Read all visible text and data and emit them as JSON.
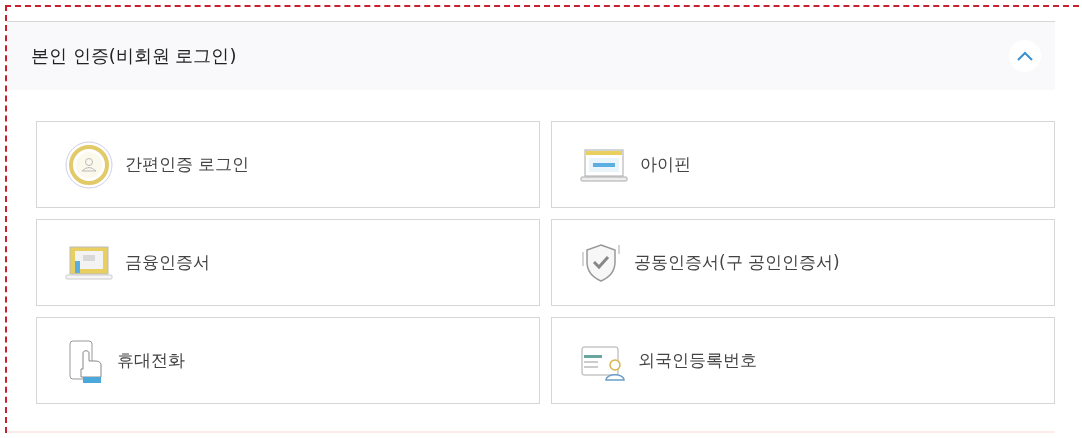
{
  "section": {
    "title": "본인 인증(비회원 로그인)",
    "expanded": true
  },
  "methods": [
    {
      "label": "간편인증 로그인"
    },
    {
      "label": "아이핀"
    },
    {
      "label": "금융인증서"
    },
    {
      "label": "공동인증서(구 공인인증서)"
    },
    {
      "label": "휴대전화"
    },
    {
      "label": "외국인등록번호"
    }
  ]
}
